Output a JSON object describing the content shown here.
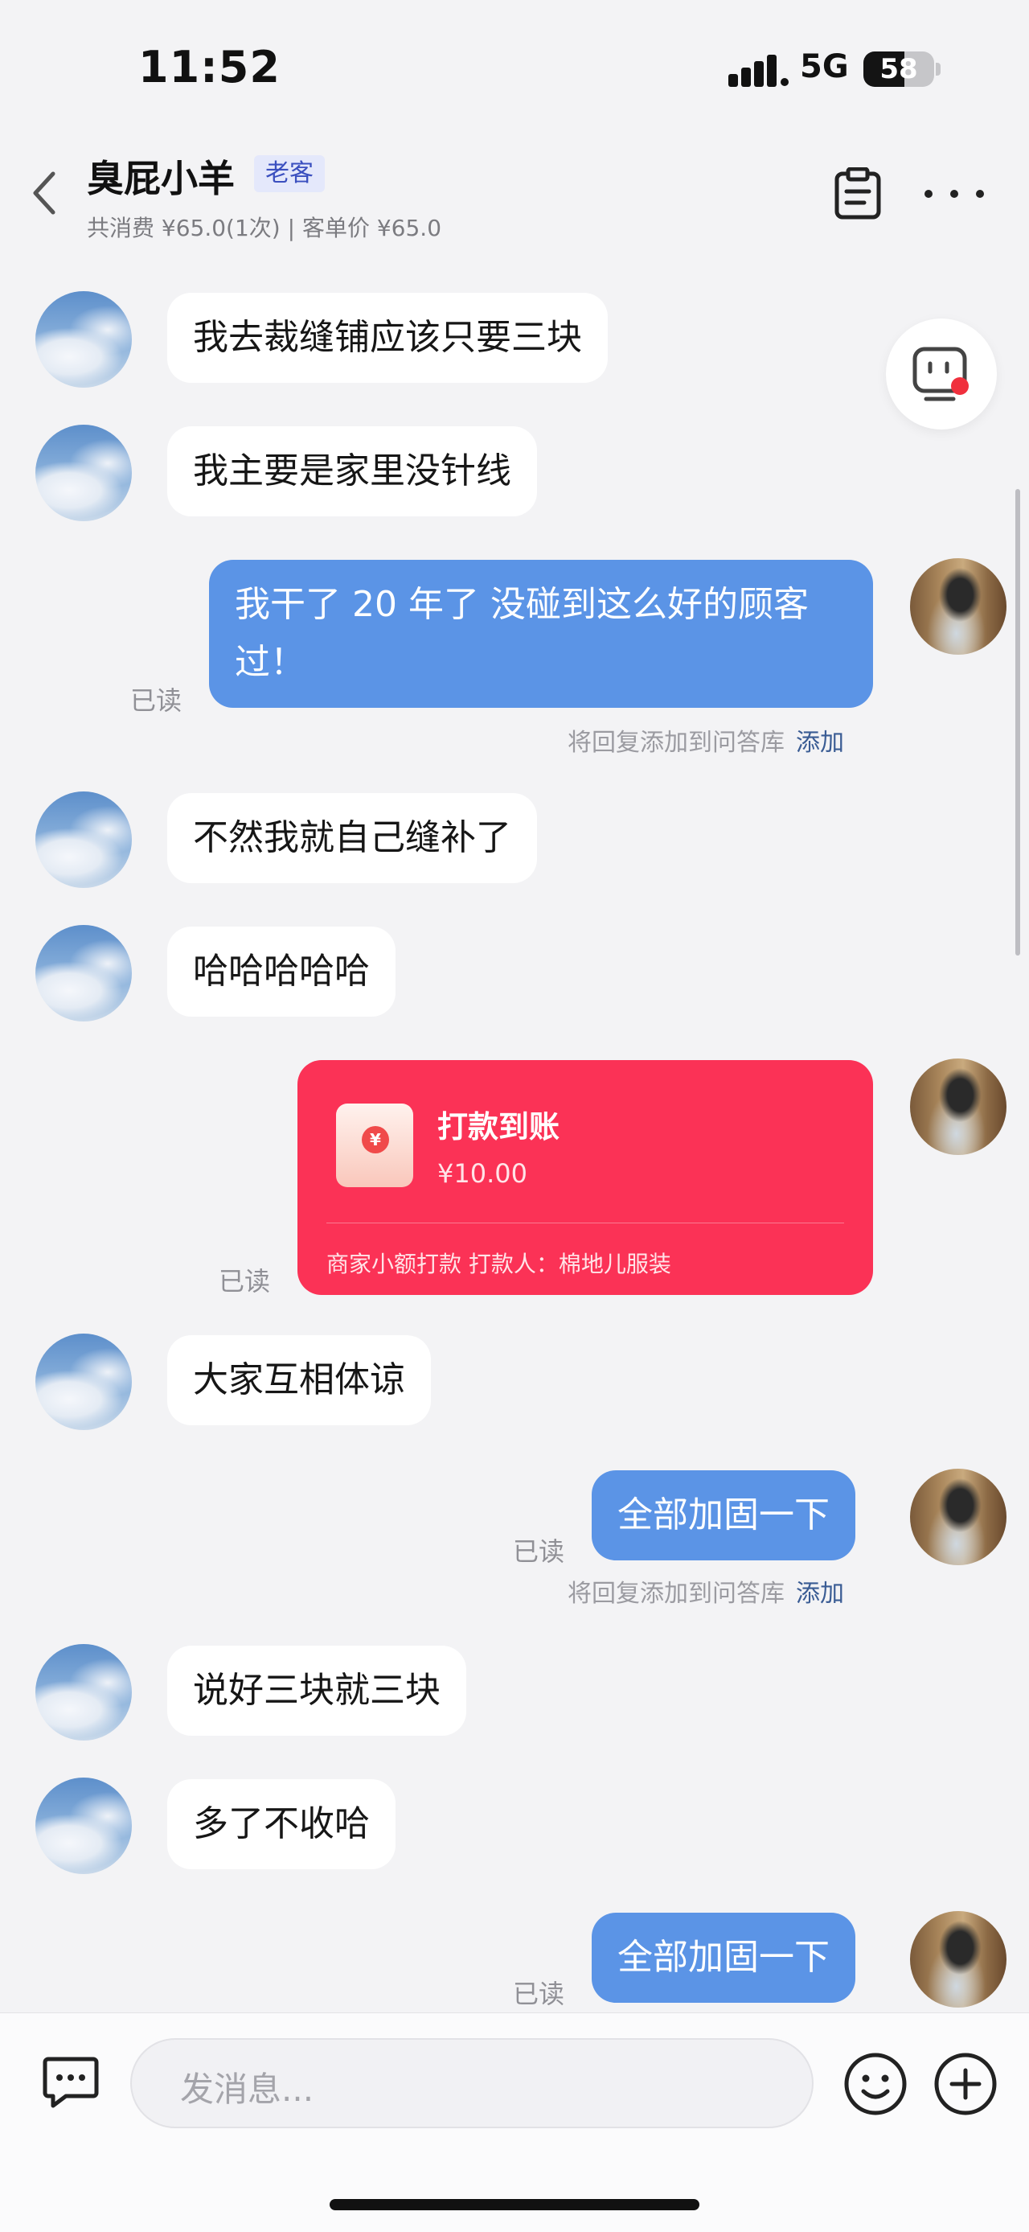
{
  "status_bar": {
    "time": "11:52",
    "network": "5G",
    "battery": "58",
    "battery_level_percent": 58
  },
  "header": {
    "title": "臭屁小羊",
    "badge": "老客",
    "subinfo": "共消费 ¥65.0(1次) | 客单价 ¥65.0"
  },
  "messages": {
    "m1": "我去裁缝铺应该只要三块",
    "m2": "我主要是家里没针线",
    "m3_line1": "我干了 20 年了 没碰到这么好的顾客",
    "m3_line2": "过！",
    "m4": "不然我就自己缝补了",
    "m5": "哈哈哈哈哈",
    "m6": "大家互相体谅",
    "m7": "全部加固一下",
    "m8": "说好三块就三块",
    "m9": "多了不收哈",
    "m10": "全部加固一下"
  },
  "read_label": "已读",
  "add_to_qa": {
    "text": "将回复添加到问答库",
    "link": "添加"
  },
  "payment": {
    "title": "打款到账",
    "amount": "¥10.00",
    "footer": "商家小额打款  打款人：棉地儿服装",
    "coin_symbol": "¥"
  },
  "input": {
    "placeholder": "发消息..."
  },
  "colors": {
    "outgoing": "#5b94e6",
    "payment": "#fb3256",
    "background": "#f3f3f5"
  }
}
